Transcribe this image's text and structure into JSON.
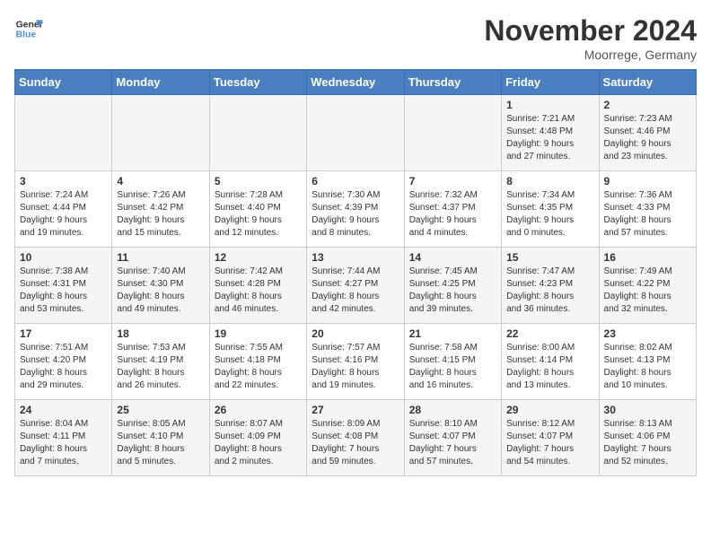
{
  "logo": {
    "line1": "General",
    "line2": "Blue"
  },
  "header": {
    "month": "November 2024",
    "location": "Moorrege, Germany"
  },
  "weekdays": [
    "Sunday",
    "Monday",
    "Tuesday",
    "Wednesday",
    "Thursday",
    "Friday",
    "Saturday"
  ],
  "weeks": [
    [
      {
        "day": "",
        "info": ""
      },
      {
        "day": "",
        "info": ""
      },
      {
        "day": "",
        "info": ""
      },
      {
        "day": "",
        "info": ""
      },
      {
        "day": "",
        "info": ""
      },
      {
        "day": "1",
        "info": "Sunrise: 7:21 AM\nSunset: 4:48 PM\nDaylight: 9 hours\nand 27 minutes."
      },
      {
        "day": "2",
        "info": "Sunrise: 7:23 AM\nSunset: 4:46 PM\nDaylight: 9 hours\nand 23 minutes."
      }
    ],
    [
      {
        "day": "3",
        "info": "Sunrise: 7:24 AM\nSunset: 4:44 PM\nDaylight: 9 hours\nand 19 minutes."
      },
      {
        "day": "4",
        "info": "Sunrise: 7:26 AM\nSunset: 4:42 PM\nDaylight: 9 hours\nand 15 minutes."
      },
      {
        "day": "5",
        "info": "Sunrise: 7:28 AM\nSunset: 4:40 PM\nDaylight: 9 hours\nand 12 minutes."
      },
      {
        "day": "6",
        "info": "Sunrise: 7:30 AM\nSunset: 4:39 PM\nDaylight: 9 hours\nand 8 minutes."
      },
      {
        "day": "7",
        "info": "Sunrise: 7:32 AM\nSunset: 4:37 PM\nDaylight: 9 hours\nand 4 minutes."
      },
      {
        "day": "8",
        "info": "Sunrise: 7:34 AM\nSunset: 4:35 PM\nDaylight: 9 hours\nand 0 minutes."
      },
      {
        "day": "9",
        "info": "Sunrise: 7:36 AM\nSunset: 4:33 PM\nDaylight: 8 hours\nand 57 minutes."
      }
    ],
    [
      {
        "day": "10",
        "info": "Sunrise: 7:38 AM\nSunset: 4:31 PM\nDaylight: 8 hours\nand 53 minutes."
      },
      {
        "day": "11",
        "info": "Sunrise: 7:40 AM\nSunset: 4:30 PM\nDaylight: 8 hours\nand 49 minutes."
      },
      {
        "day": "12",
        "info": "Sunrise: 7:42 AM\nSunset: 4:28 PM\nDaylight: 8 hours\nand 46 minutes."
      },
      {
        "day": "13",
        "info": "Sunrise: 7:44 AM\nSunset: 4:27 PM\nDaylight: 8 hours\nand 42 minutes."
      },
      {
        "day": "14",
        "info": "Sunrise: 7:45 AM\nSunset: 4:25 PM\nDaylight: 8 hours\nand 39 minutes."
      },
      {
        "day": "15",
        "info": "Sunrise: 7:47 AM\nSunset: 4:23 PM\nDaylight: 8 hours\nand 36 minutes."
      },
      {
        "day": "16",
        "info": "Sunrise: 7:49 AM\nSunset: 4:22 PM\nDaylight: 8 hours\nand 32 minutes."
      }
    ],
    [
      {
        "day": "17",
        "info": "Sunrise: 7:51 AM\nSunset: 4:20 PM\nDaylight: 8 hours\nand 29 minutes."
      },
      {
        "day": "18",
        "info": "Sunrise: 7:53 AM\nSunset: 4:19 PM\nDaylight: 8 hours\nand 26 minutes."
      },
      {
        "day": "19",
        "info": "Sunrise: 7:55 AM\nSunset: 4:18 PM\nDaylight: 8 hours\nand 22 minutes."
      },
      {
        "day": "20",
        "info": "Sunrise: 7:57 AM\nSunset: 4:16 PM\nDaylight: 8 hours\nand 19 minutes."
      },
      {
        "day": "21",
        "info": "Sunrise: 7:58 AM\nSunset: 4:15 PM\nDaylight: 8 hours\nand 16 minutes."
      },
      {
        "day": "22",
        "info": "Sunrise: 8:00 AM\nSunset: 4:14 PM\nDaylight: 8 hours\nand 13 minutes."
      },
      {
        "day": "23",
        "info": "Sunrise: 8:02 AM\nSunset: 4:13 PM\nDaylight: 8 hours\nand 10 minutes."
      }
    ],
    [
      {
        "day": "24",
        "info": "Sunrise: 8:04 AM\nSunset: 4:11 PM\nDaylight: 8 hours\nand 7 minutes."
      },
      {
        "day": "25",
        "info": "Sunrise: 8:05 AM\nSunset: 4:10 PM\nDaylight: 8 hours\nand 5 minutes."
      },
      {
        "day": "26",
        "info": "Sunrise: 8:07 AM\nSunset: 4:09 PM\nDaylight: 8 hours\nand 2 minutes."
      },
      {
        "day": "27",
        "info": "Sunrise: 8:09 AM\nSunset: 4:08 PM\nDaylight: 7 hours\nand 59 minutes."
      },
      {
        "day": "28",
        "info": "Sunrise: 8:10 AM\nSunset: 4:07 PM\nDaylight: 7 hours\nand 57 minutes."
      },
      {
        "day": "29",
        "info": "Sunrise: 8:12 AM\nSunset: 4:07 PM\nDaylight: 7 hours\nand 54 minutes."
      },
      {
        "day": "30",
        "info": "Sunrise: 8:13 AM\nSunset: 4:06 PM\nDaylight: 7 hours\nand 52 minutes."
      }
    ]
  ]
}
